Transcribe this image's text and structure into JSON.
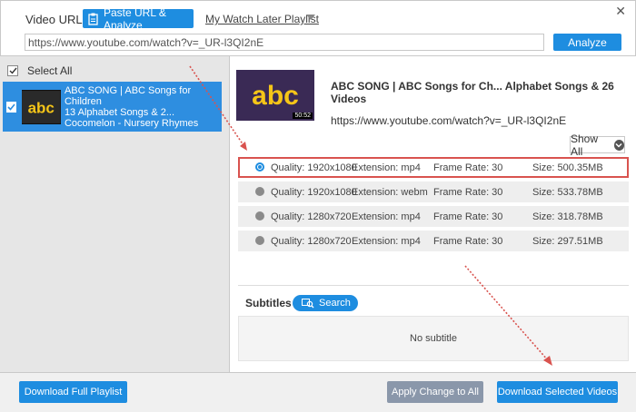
{
  "header": {
    "close_glyph": "✕",
    "url_label": "Video URL:",
    "paste_button": "Paste URL & Analyze",
    "playlist_link": "My Watch Later Playlist",
    "url_value": "https://www.youtube.com/watch?v=_UR-l3QI2nE",
    "analyze_button": "Analyze"
  },
  "sidebar": {
    "select_all": "Select All",
    "items": [
      {
        "title_line1": "ABC SONG | ABC Songs for Children",
        "title_line2": "13 Alphabet Songs & 2...",
        "channel": "Cocomelon - Nursery Rhymes",
        "thumb_text": "abc"
      }
    ]
  },
  "detail": {
    "thumb_text": "abc",
    "duration": "50:52",
    "title": "ABC SONG | ABC Songs for Ch... Alphabet Songs & 26 Videos",
    "url": "https://www.youtube.com/watch?v=_UR-l3QI2nE",
    "show_all": "Show All",
    "formats": [
      {
        "quality": "Quality: 1920x1080",
        "extension": "Extension: mp4",
        "frame_rate": "Frame Rate: 30",
        "size": "Size: 500.35MB"
      },
      {
        "quality": "Quality: 1920x1080",
        "extension": "Extension: webm",
        "frame_rate": "Frame Rate: 30",
        "size": "Size: 533.78MB"
      },
      {
        "quality": "Quality: 1280x720",
        "extension": "Extension: mp4",
        "frame_rate": "Frame Rate: 30",
        "size": "Size: 318.78MB"
      },
      {
        "quality": "Quality: 1280x720",
        "extension": "Extension: mp4",
        "frame_rate": "Frame Rate: 30",
        "size": "Size: 297.51MB"
      }
    ],
    "subtitles_label": "Subtitles",
    "search_button": "Search",
    "no_subtitle": "No subtitle"
  },
  "footer": {
    "download_playlist": "Download Full Playlist",
    "apply_change": "Apply Change to All",
    "download_selected": "Download Selected Videos"
  },
  "colors": {
    "accent": "#1e8de0",
    "selected_border": "#d9534f",
    "disabled_button": "#8a97aa",
    "annotation_arrow": "#d9534f"
  }
}
